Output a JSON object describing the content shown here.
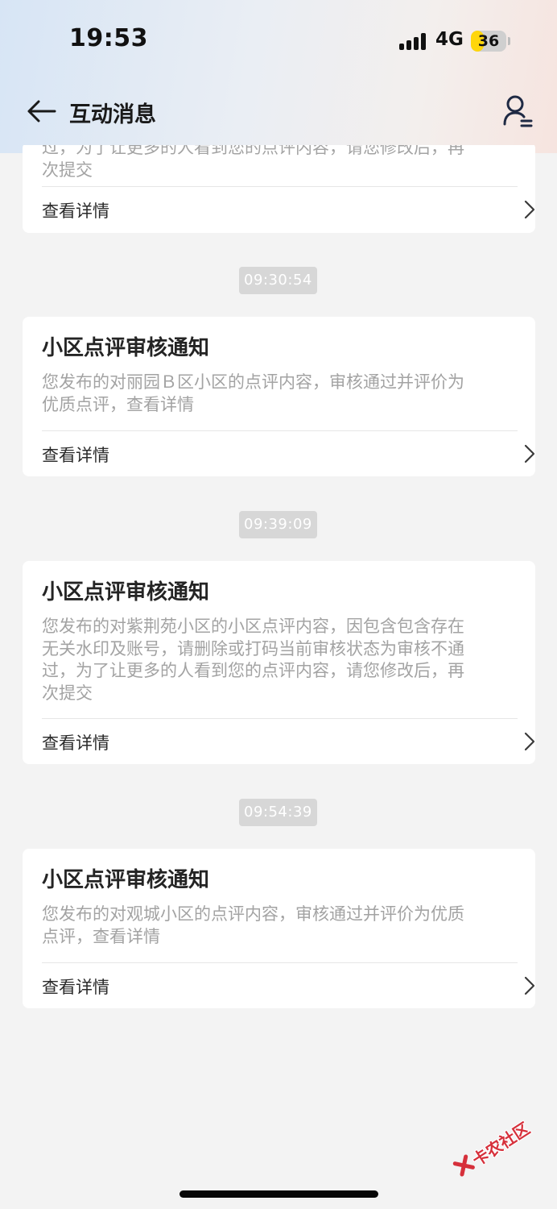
{
  "status_bar": {
    "time": "19:53",
    "network": "4G",
    "battery": "36",
    "battery_level": 0.36
  },
  "nav": {
    "title": "互动消息",
    "back_icon": "arrow-left-icon",
    "user_icon": "user-settings-icon"
  },
  "cards": [
    {
      "title": "",
      "body_lines": [
        "过，为了让更多的人看到您的点评内容，请您修改后，再",
        "次提交"
      ],
      "link_label": "查看详情"
    },
    {
      "title": "小区点评审核通知",
      "body_lines": [
        "您发布的对丽园Ｂ区小区的点评内容，审核通过并评价为",
        "优质点评，查看详情"
      ],
      "link_label": "查看详情"
    },
    {
      "title": "小区点评审核通知",
      "body_lines": [
        "您发布的对紫荆苑小区的小区点评内容，因包含包含存在",
        "无关水印及账号，请删除或打码当前审核状态为审核不通",
        "过，为了让更多的人看到您的点评内容，请您修改后，再",
        "次提交"
      ],
      "link_label": "查看详情"
    },
    {
      "title": "小区点评审核通知",
      "body_lines": [
        "您发布的对观城小区的点评内容，审核通过并评价为优质",
        "点评，查看详情"
      ],
      "link_label": "查看详情"
    }
  ],
  "timestamps": [
    "09:30:54",
    "09:39:09",
    "09:54:39"
  ],
  "watermark": "卡农社区",
  "colors": {
    "accent_watermark": "#d6303b",
    "card_bg": "#ffffff",
    "page_bg": "#f3f3f3",
    "time_pill_bg": "#d7d7d7"
  }
}
